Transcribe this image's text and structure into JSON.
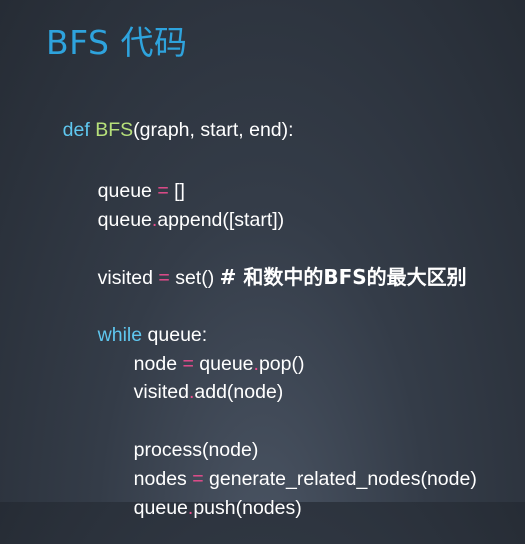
{
  "title": "BFS 代码",
  "code": {
    "def_line": {
      "keyword": "def",
      "function_name": "BFS",
      "params": "(graph, start, end):"
    },
    "queue_init": {
      "var": "queue",
      "op": "=",
      "rhs": "[]"
    },
    "queue_append": {
      "var": "queue",
      "dot": ".",
      "call": "append([start])"
    },
    "visited_init": {
      "var": "visited",
      "op": "=",
      "rhs": "set()",
      "comment": "# 和数中的BFS的最大区别"
    },
    "while_line": {
      "keyword": "while",
      "cond": "queue:"
    },
    "node_pop": {
      "var": "node",
      "op": "=",
      "obj": "queue",
      "dot": ".",
      "call": "pop()"
    },
    "visited_add": {
      "obj": "visited",
      "dot": ".",
      "call": "add(node)"
    },
    "process_line": {
      "call": "process(node)"
    },
    "nodes_line": {
      "var": "nodes",
      "op": "=",
      "rhs": "generate_related_nodes(node)"
    },
    "queue_push": {
      "obj": "queue",
      "dot": ".",
      "call": "push(nodes)"
    }
  },
  "colors": {
    "title": "#2ea3dd",
    "keyword": "#5fc7ef",
    "function_name": "#b6e07a",
    "operator": "#ee4c8f",
    "text": "#ffffff"
  }
}
